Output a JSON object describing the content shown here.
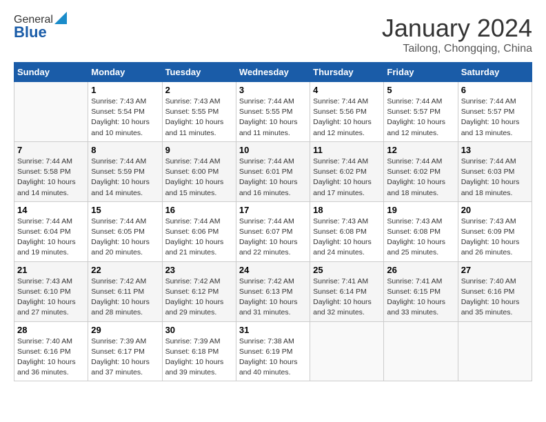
{
  "logo": {
    "line1": "General",
    "line2": "Blue"
  },
  "title": "January 2024",
  "subtitle": "Tailong, Chongqing, China",
  "weekdays": [
    "Sunday",
    "Monday",
    "Tuesday",
    "Wednesday",
    "Thursday",
    "Friday",
    "Saturday"
  ],
  "weeks": [
    [
      {
        "day": "",
        "sunrise": "",
        "sunset": "",
        "daylight": ""
      },
      {
        "day": "1",
        "sunrise": "Sunrise: 7:43 AM",
        "sunset": "Sunset: 5:54 PM",
        "daylight": "Daylight: 10 hours and 10 minutes."
      },
      {
        "day": "2",
        "sunrise": "Sunrise: 7:43 AM",
        "sunset": "Sunset: 5:55 PM",
        "daylight": "Daylight: 10 hours and 11 minutes."
      },
      {
        "day": "3",
        "sunrise": "Sunrise: 7:44 AM",
        "sunset": "Sunset: 5:55 PM",
        "daylight": "Daylight: 10 hours and 11 minutes."
      },
      {
        "day": "4",
        "sunrise": "Sunrise: 7:44 AM",
        "sunset": "Sunset: 5:56 PM",
        "daylight": "Daylight: 10 hours and 12 minutes."
      },
      {
        "day": "5",
        "sunrise": "Sunrise: 7:44 AM",
        "sunset": "Sunset: 5:57 PM",
        "daylight": "Daylight: 10 hours and 12 minutes."
      },
      {
        "day": "6",
        "sunrise": "Sunrise: 7:44 AM",
        "sunset": "Sunset: 5:57 PM",
        "daylight": "Daylight: 10 hours and 13 minutes."
      }
    ],
    [
      {
        "day": "7",
        "sunrise": "Sunrise: 7:44 AM",
        "sunset": "Sunset: 5:58 PM",
        "daylight": "Daylight: 10 hours and 14 minutes."
      },
      {
        "day": "8",
        "sunrise": "Sunrise: 7:44 AM",
        "sunset": "Sunset: 5:59 PM",
        "daylight": "Daylight: 10 hours and 14 minutes."
      },
      {
        "day": "9",
        "sunrise": "Sunrise: 7:44 AM",
        "sunset": "Sunset: 6:00 PM",
        "daylight": "Daylight: 10 hours and 15 minutes."
      },
      {
        "day": "10",
        "sunrise": "Sunrise: 7:44 AM",
        "sunset": "Sunset: 6:01 PM",
        "daylight": "Daylight: 10 hours and 16 minutes."
      },
      {
        "day": "11",
        "sunrise": "Sunrise: 7:44 AM",
        "sunset": "Sunset: 6:02 PM",
        "daylight": "Daylight: 10 hours and 17 minutes."
      },
      {
        "day": "12",
        "sunrise": "Sunrise: 7:44 AM",
        "sunset": "Sunset: 6:02 PM",
        "daylight": "Daylight: 10 hours and 18 minutes."
      },
      {
        "day": "13",
        "sunrise": "Sunrise: 7:44 AM",
        "sunset": "Sunset: 6:03 PM",
        "daylight": "Daylight: 10 hours and 18 minutes."
      }
    ],
    [
      {
        "day": "14",
        "sunrise": "Sunrise: 7:44 AM",
        "sunset": "Sunset: 6:04 PM",
        "daylight": "Daylight: 10 hours and 19 minutes."
      },
      {
        "day": "15",
        "sunrise": "Sunrise: 7:44 AM",
        "sunset": "Sunset: 6:05 PM",
        "daylight": "Daylight: 10 hours and 20 minutes."
      },
      {
        "day": "16",
        "sunrise": "Sunrise: 7:44 AM",
        "sunset": "Sunset: 6:06 PM",
        "daylight": "Daylight: 10 hours and 21 minutes."
      },
      {
        "day": "17",
        "sunrise": "Sunrise: 7:44 AM",
        "sunset": "Sunset: 6:07 PM",
        "daylight": "Daylight: 10 hours and 22 minutes."
      },
      {
        "day": "18",
        "sunrise": "Sunrise: 7:43 AM",
        "sunset": "Sunset: 6:08 PM",
        "daylight": "Daylight: 10 hours and 24 minutes."
      },
      {
        "day": "19",
        "sunrise": "Sunrise: 7:43 AM",
        "sunset": "Sunset: 6:08 PM",
        "daylight": "Daylight: 10 hours and 25 minutes."
      },
      {
        "day": "20",
        "sunrise": "Sunrise: 7:43 AM",
        "sunset": "Sunset: 6:09 PM",
        "daylight": "Daylight: 10 hours and 26 minutes."
      }
    ],
    [
      {
        "day": "21",
        "sunrise": "Sunrise: 7:43 AM",
        "sunset": "Sunset: 6:10 PM",
        "daylight": "Daylight: 10 hours and 27 minutes."
      },
      {
        "day": "22",
        "sunrise": "Sunrise: 7:42 AM",
        "sunset": "Sunset: 6:11 PM",
        "daylight": "Daylight: 10 hours and 28 minutes."
      },
      {
        "day": "23",
        "sunrise": "Sunrise: 7:42 AM",
        "sunset": "Sunset: 6:12 PM",
        "daylight": "Daylight: 10 hours and 29 minutes."
      },
      {
        "day": "24",
        "sunrise": "Sunrise: 7:42 AM",
        "sunset": "Sunset: 6:13 PM",
        "daylight": "Daylight: 10 hours and 31 minutes."
      },
      {
        "day": "25",
        "sunrise": "Sunrise: 7:41 AM",
        "sunset": "Sunset: 6:14 PM",
        "daylight": "Daylight: 10 hours and 32 minutes."
      },
      {
        "day": "26",
        "sunrise": "Sunrise: 7:41 AM",
        "sunset": "Sunset: 6:15 PM",
        "daylight": "Daylight: 10 hours and 33 minutes."
      },
      {
        "day": "27",
        "sunrise": "Sunrise: 7:40 AM",
        "sunset": "Sunset: 6:16 PM",
        "daylight": "Daylight: 10 hours and 35 minutes."
      }
    ],
    [
      {
        "day": "28",
        "sunrise": "Sunrise: 7:40 AM",
        "sunset": "Sunset: 6:16 PM",
        "daylight": "Daylight: 10 hours and 36 minutes."
      },
      {
        "day": "29",
        "sunrise": "Sunrise: 7:39 AM",
        "sunset": "Sunset: 6:17 PM",
        "daylight": "Daylight: 10 hours and 37 minutes."
      },
      {
        "day": "30",
        "sunrise": "Sunrise: 7:39 AM",
        "sunset": "Sunset: 6:18 PM",
        "daylight": "Daylight: 10 hours and 39 minutes."
      },
      {
        "day": "31",
        "sunrise": "Sunrise: 7:38 AM",
        "sunset": "Sunset: 6:19 PM",
        "daylight": "Daylight: 10 hours and 40 minutes."
      },
      {
        "day": "",
        "sunrise": "",
        "sunset": "",
        "daylight": ""
      },
      {
        "day": "",
        "sunrise": "",
        "sunset": "",
        "daylight": ""
      },
      {
        "day": "",
        "sunrise": "",
        "sunset": "",
        "daylight": ""
      }
    ]
  ]
}
